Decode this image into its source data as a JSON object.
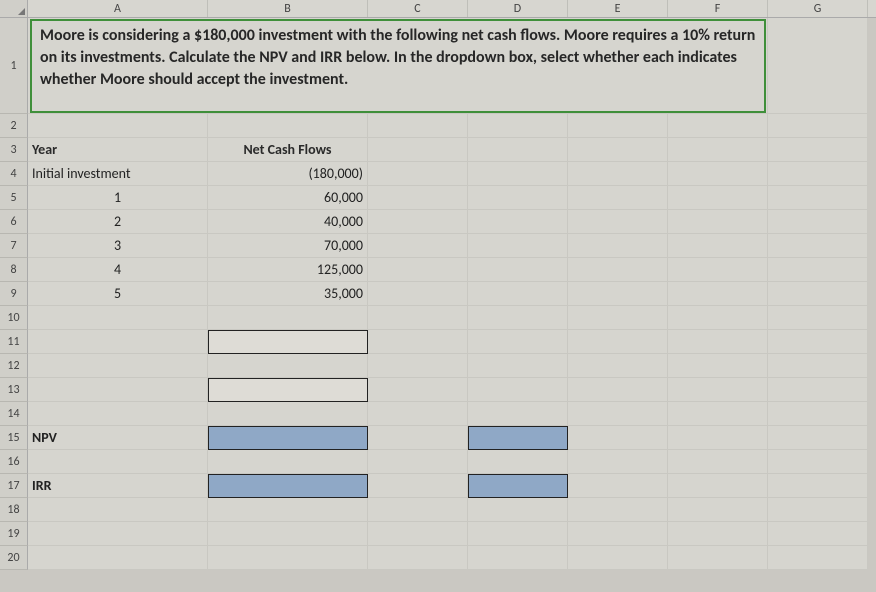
{
  "columns": [
    "A",
    "B",
    "C",
    "D",
    "E",
    "F",
    "G"
  ],
  "rowNumbers": [
    "1",
    "2",
    "3",
    "4",
    "5",
    "6",
    "7",
    "8",
    "9",
    "10",
    "11",
    "12",
    "13",
    "14",
    "15",
    "16",
    "17",
    "18",
    "19",
    "20"
  ],
  "problem": "Moore is considering a $180,000 investment with the following net cash flows. Moore requires a 10% return on its investments. Calculate the NPV and IRR below. In the dropdown box, select whether each indicates whether Moore should accept the investment.",
  "headers": {
    "year": "Year",
    "ncf": "Net Cash Flows"
  },
  "rowsData": {
    "r4": {
      "a": "Initial investment",
      "b": "(180,000)"
    },
    "r5": {
      "a": "1",
      "b": "60,000"
    },
    "r6": {
      "a": "2",
      "b": "40,000"
    },
    "r7": {
      "a": "3",
      "b": "70,000"
    },
    "r8": {
      "a": "4",
      "b": "125,000"
    },
    "r9": {
      "a": "5",
      "b": "35,000"
    }
  },
  "labels": {
    "npv": "NPV",
    "irr": "IRR"
  },
  "chart_data": {
    "type": "table",
    "title": "Net Cash Flows",
    "categories": [
      "Initial investment",
      "1",
      "2",
      "3",
      "4",
      "5"
    ],
    "values": [
      -180000,
      60000,
      40000,
      70000,
      125000,
      35000
    ],
    "required_return": 0.1
  }
}
